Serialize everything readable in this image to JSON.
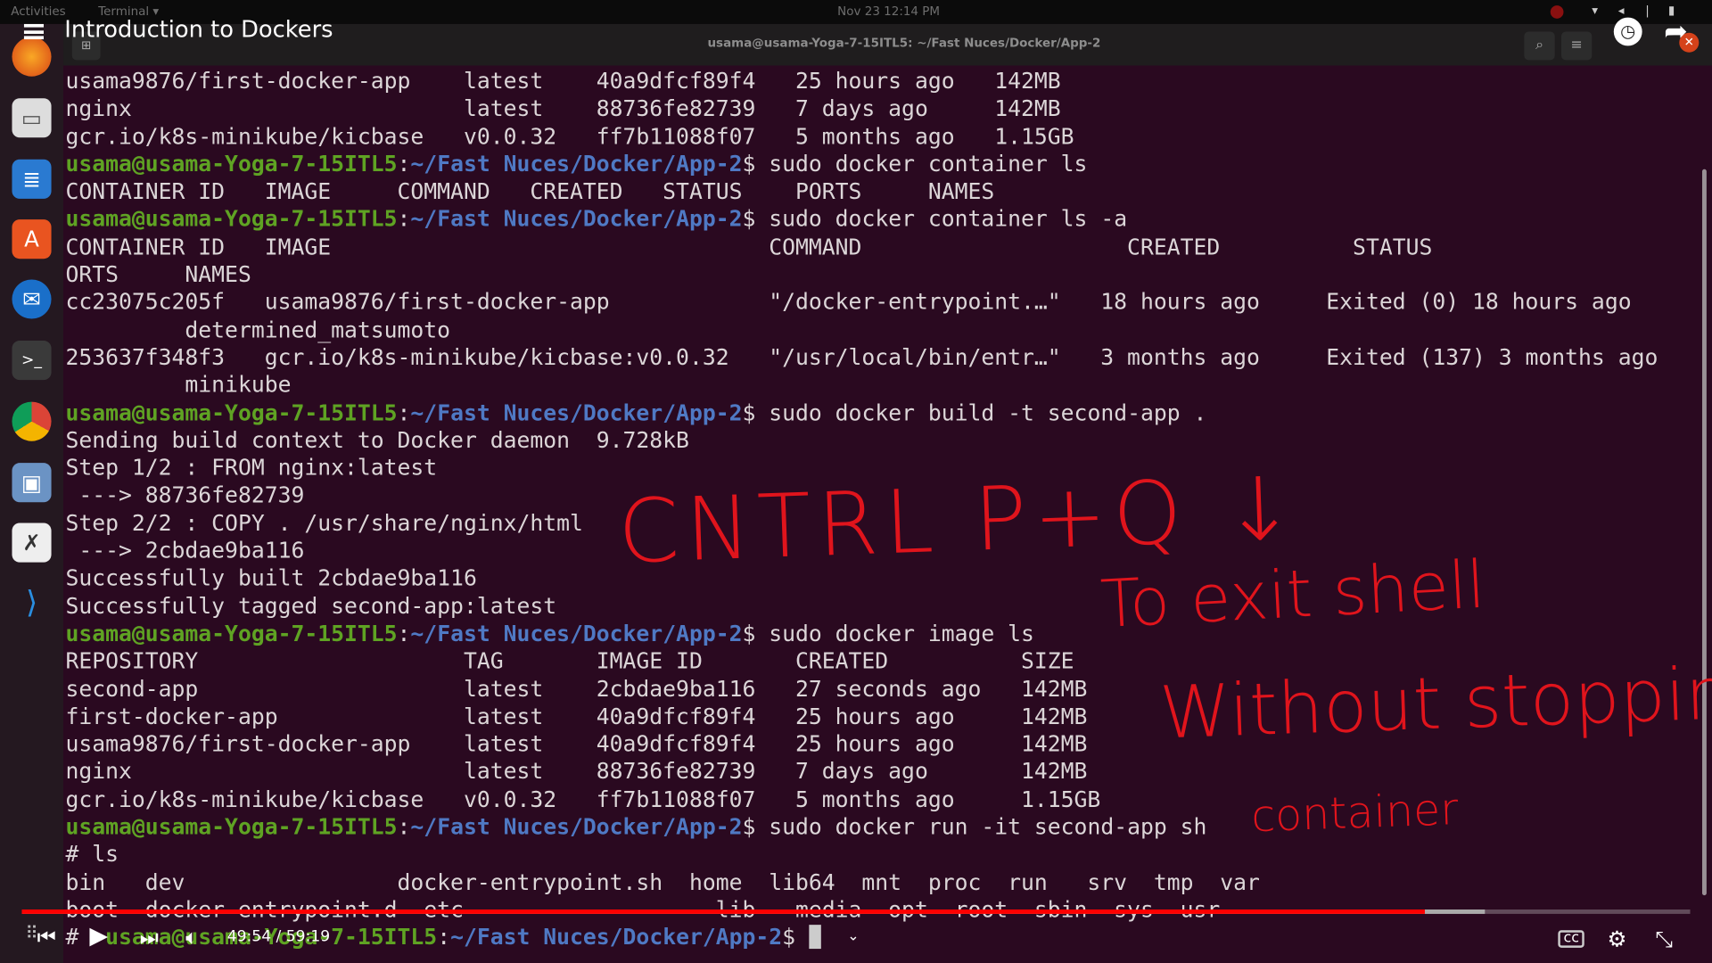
{
  "system_bar": {
    "activities": "Activities",
    "app": "Terminal ▾",
    "clock": "Nov 23  12:14 PM"
  },
  "window": {
    "title": "usama@usama-Yoga-7-15ITL5: ~/Fast Nuces/Docker/App-2"
  },
  "video": {
    "title": "Introduction to Dockers",
    "current_time": "49:54",
    "duration": "59:19",
    "time_display": "49:54 / 59:19",
    "played_fraction": 0.841,
    "buffered_fraction": 0.877,
    "accent": "#ff0000"
  },
  "dock": {
    "items": [
      "firefox",
      "files",
      "writer",
      "software",
      "thunderbird",
      "terminal",
      "chrome",
      "image-viewer",
      "xournal",
      "vscode"
    ]
  },
  "prompt": {
    "user": "usama@usama-Yoga-7-15ITL5",
    "path": "~/Fast Nuces/Docker/App-2"
  },
  "terminal_lines": [
    {
      "text": "usama9876/first-docker-app    latest    40a9dfcf89f4   25 hours ago   142MB"
    },
    {
      "text": "nginx                         latest    88736fe82739   7 days ago     142MB"
    },
    {
      "text": "gcr.io/k8s-minikube/kicbase   v0.0.32   ff7b11088f07   5 months ago   1.15GB"
    },
    {
      "cmd": "$ sudo docker container ls"
    },
    {
      "text": "CONTAINER ID   IMAGE     COMMAND   CREATED   STATUS    PORTS     NAMES"
    },
    {
      "cmd": "$ sudo docker container ls -a"
    },
    {
      "text": "CONTAINER ID   IMAGE                                 COMMAND                    CREATED          STATUS                        P"
    },
    {
      "text": "ORTS     NAMES"
    },
    {
      "text": "cc23075c205f   usama9876/first-docker-app            \"/docker-entrypoint.…\"   18 hours ago     Exited (0) 18 hours ago"
    },
    {
      "text": "         determined_matsumoto"
    },
    {
      "text": "253637f348f3   gcr.io/k8s-minikube/kicbase:v0.0.32   \"/usr/local/bin/entr…\"   3 months ago     Exited (137) 3 months ago"
    },
    {
      "text": "         minikube"
    },
    {
      "cmd": "$ sudo docker build -t second-app ."
    },
    {
      "text": "Sending build context to Docker daemon  9.728kB"
    },
    {
      "text": "Step 1/2 : FROM nginx:latest"
    },
    {
      "text": " ---> 88736fe82739"
    },
    {
      "text": "Step 2/2 : COPY . /usr/share/nginx/html"
    },
    {
      "text": " ---> 2cbdae9ba116"
    },
    {
      "text": "Successfully built 2cbdae9ba116"
    },
    {
      "text": "Successfully tagged second-app:latest"
    },
    {
      "cmd": "$ sudo docker image ls"
    },
    {
      "text": "REPOSITORY                    TAG       IMAGE ID       CREATED          SIZE"
    },
    {
      "text": "second-app                    latest    2cbdae9ba116   27 seconds ago   142MB"
    },
    {
      "text": "first-docker-app              latest    40a9dfcf89f4   25 hours ago     142MB"
    },
    {
      "text": "usama9876/first-docker-app    latest    40a9dfcf89f4   25 hours ago     142MB"
    },
    {
      "text": "nginx                         latest    88736fe82739   7 days ago       142MB"
    },
    {
      "text": "gcr.io/k8s-minikube/kicbase   v0.0.32   ff7b11088f07   5 months ago     1.15GB"
    },
    {
      "cmd": "$ sudo docker run -it second-app sh"
    },
    {
      "text": "# ls"
    },
    {
      "text": "bin   dev                docker-entrypoint.sh  home  lib64  mnt  proc  run   srv  tmp  var"
    },
    {
      "text": "boot  docker-entrypoint.d  etc                   lib   media  opt  root  sbin  sys  usr"
    },
    {
      "pre": "#  ",
      "cmd": "$ ",
      "cursor": true
    }
  ],
  "annotations": {
    "line1": "CNTRL P+Q ↓",
    "line2": "To exit shell",
    "line3": "Without stopping",
    "line4": "container",
    "color": "#e0141c"
  }
}
